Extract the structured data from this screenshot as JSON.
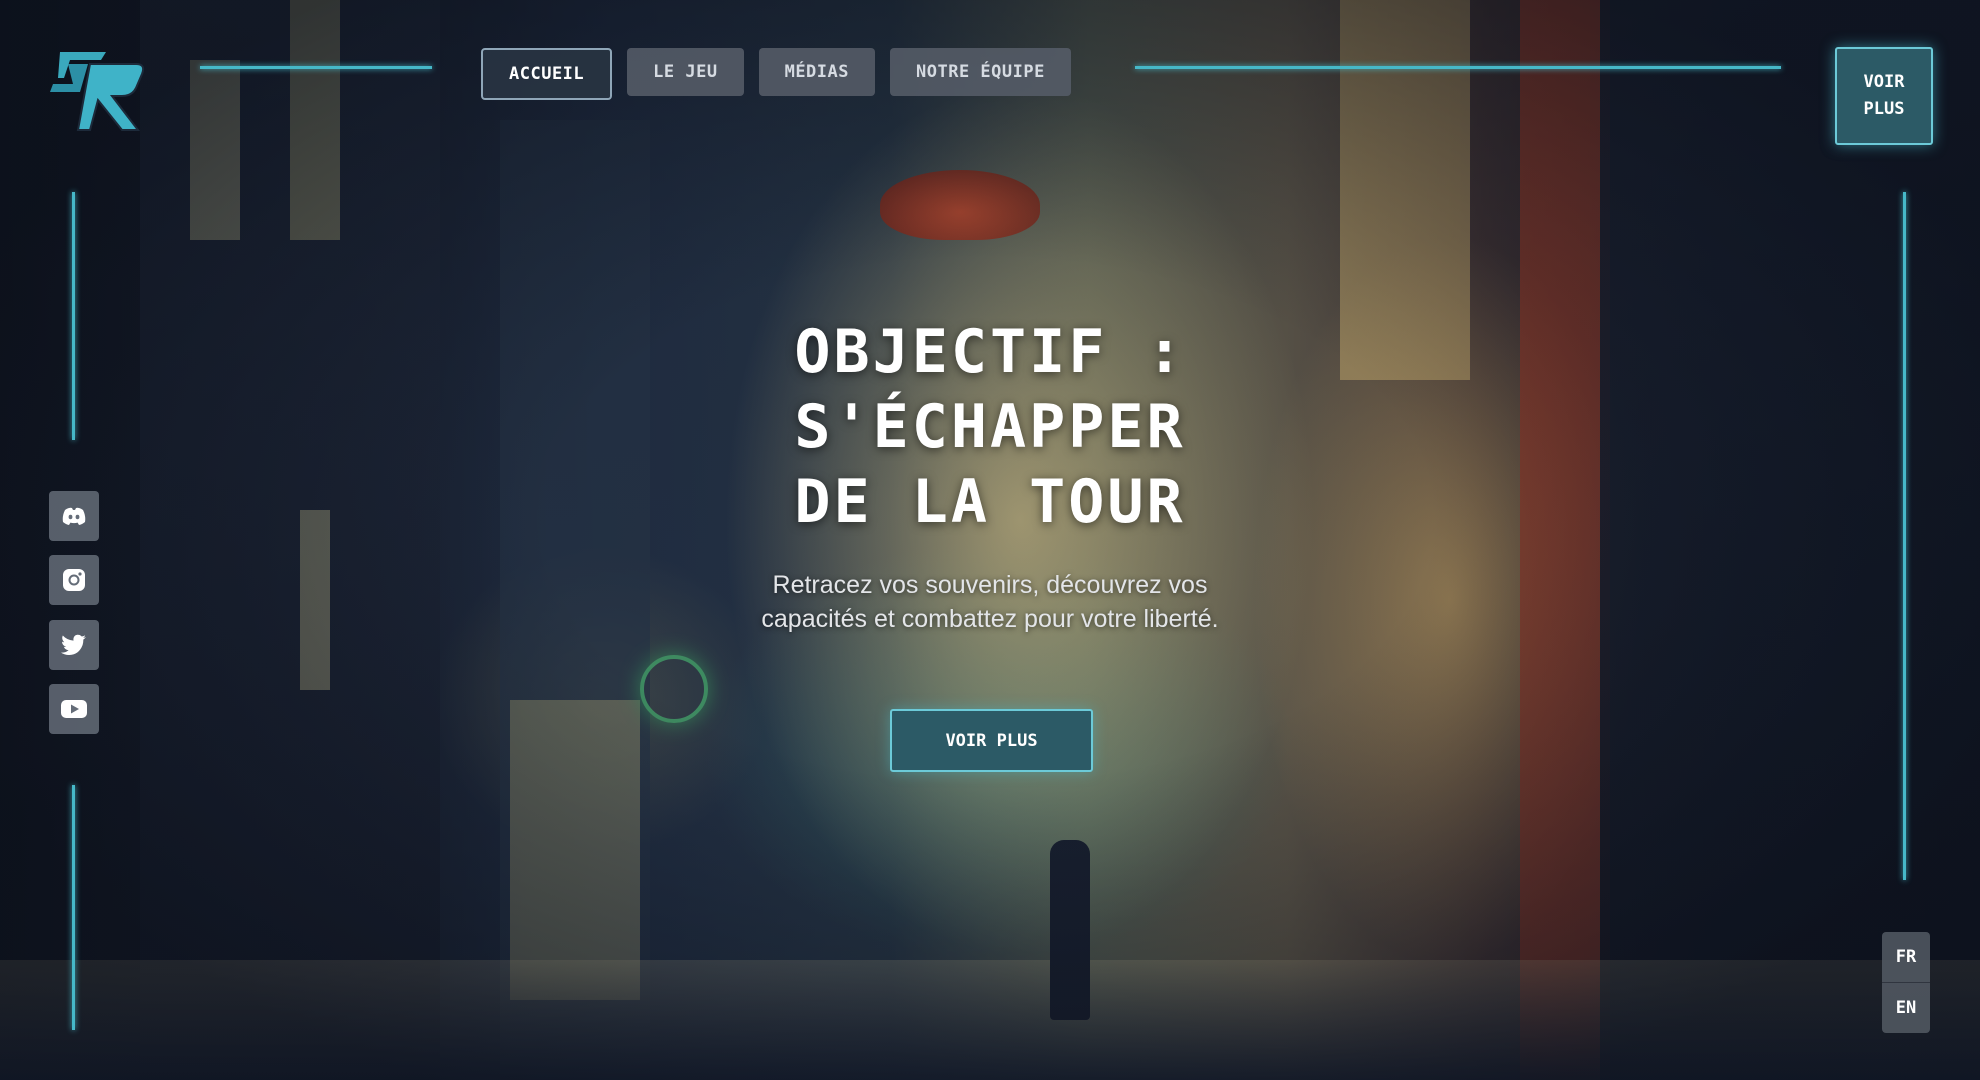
{
  "nav": {
    "items": [
      {
        "label": "ACCUEIL",
        "active": true
      },
      {
        "label": "LE JEU",
        "active": false
      },
      {
        "label": "MÉDIAS",
        "active": false
      },
      {
        "label": "NOTRE ÉQUIPE",
        "active": false
      }
    ],
    "cta_line1": "VOIR",
    "cta_line2": "PLUS"
  },
  "social": [
    {
      "icon": "discord-icon"
    },
    {
      "icon": "instagram-icon"
    },
    {
      "icon": "twitter-icon"
    },
    {
      "icon": "youtube-icon"
    }
  ],
  "hero": {
    "title_line1": "OBJECTIF :",
    "title_line2": "S'ÉCHAPPER",
    "title_line3": "DE LA TOUR",
    "subtitle": "Retracez vos souvenirs, découvrez vos capacités et combattez pour votre liberté.",
    "button": "VOIR PLUS"
  },
  "languages": [
    "FR",
    "EN"
  ],
  "colors": {
    "accent": "#46b8c8",
    "button_fill": "#2c5a66",
    "nav_button": "#555c68"
  }
}
